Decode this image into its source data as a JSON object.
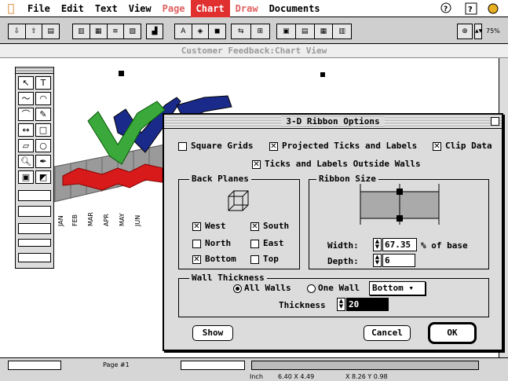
{
  "menubar": {
    "apple": "",
    "items": [
      {
        "label": "File",
        "style": "normal"
      },
      {
        "label": "Edit",
        "style": "normal"
      },
      {
        "label": "Text",
        "style": "normal"
      },
      {
        "label": "View",
        "style": "normal"
      },
      {
        "label": "Page",
        "style": "gray"
      },
      {
        "label": "Chart",
        "style": "active"
      },
      {
        "label": "Draw",
        "style": "gray"
      },
      {
        "label": "Documents",
        "style": "normal"
      }
    ],
    "zoom": "75%"
  },
  "document": {
    "title": "Customer Feedback:Chart View"
  },
  "chart": {
    "tick_labels": [
      "JAN",
      "FEB",
      "MAR",
      "APR",
      "MAY",
      "JUN"
    ],
    "colors": {
      "green": "#3aa83a",
      "blue": "#1a2a8a",
      "red": "#d81a1a",
      "floor": "#9a9a9a"
    }
  },
  "dialog": {
    "title": "3-D Ribbon Options",
    "square_grids": {
      "label": "Square Grids",
      "checked": false
    },
    "projected_ticks": {
      "label": "Projected Ticks and Labels",
      "checked": true
    },
    "clip_data": {
      "label": "Clip Data",
      "checked": true
    },
    "ticks_outside": {
      "label": "Ticks and Labels Outside Walls",
      "checked": true
    },
    "back_planes": {
      "title": "Back Planes",
      "west": {
        "label": "West",
        "checked": true
      },
      "south": {
        "label": "South",
        "checked": true
      },
      "north": {
        "label": "North",
        "checked": false
      },
      "east": {
        "label": "East",
        "checked": false
      },
      "bottom": {
        "label": "Bottom",
        "checked": true
      },
      "top": {
        "label": "Top",
        "checked": false
      }
    },
    "ribbon_size": {
      "title": "Ribbon Size",
      "width_label": "Width:",
      "width_value": "67.35",
      "width_suffix": "% of base",
      "depth_label": "Depth:",
      "depth_value": "6"
    },
    "wall_thickness": {
      "title": "Wall Thickness",
      "all_walls": "All Walls",
      "one_wall": "One Wall",
      "one_wall_select": "Bottom",
      "thickness_label": "Thickness",
      "thickness_value": "20",
      "selected": "all"
    },
    "show_button": "Show",
    "cancel_button": "Cancel",
    "ok_button": "OK"
  },
  "status": {
    "page": "Page #1",
    "units": "Inch",
    "size": "6.40 X 4.49",
    "coords": "X 8.26 Y 0.98"
  }
}
